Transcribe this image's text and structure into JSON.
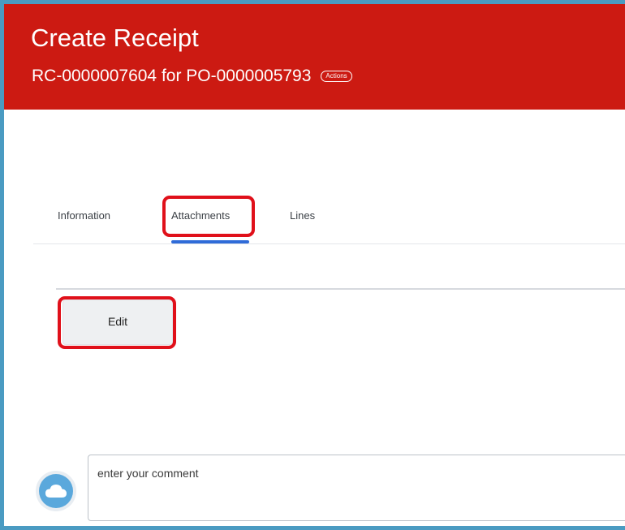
{
  "header": {
    "title": "Create Receipt",
    "subtitle": "RC-0000007604 for PO-0000005793",
    "actions_label": "Actions",
    "background_color": "#cc1a12"
  },
  "tabs": [
    {
      "label": "Information",
      "active": false
    },
    {
      "label": "Attachments",
      "active": true
    },
    {
      "label": "Lines",
      "active": false
    }
  ],
  "attachments": {
    "edit_label": "Edit"
  },
  "comment": {
    "placeholder": "enter your comment",
    "value": ""
  },
  "icons": {
    "avatar": "cloud-icon"
  },
  "colors": {
    "accent": "#2f6bd8",
    "highlight": "#e0101a",
    "frame": "#4a9bc2"
  }
}
